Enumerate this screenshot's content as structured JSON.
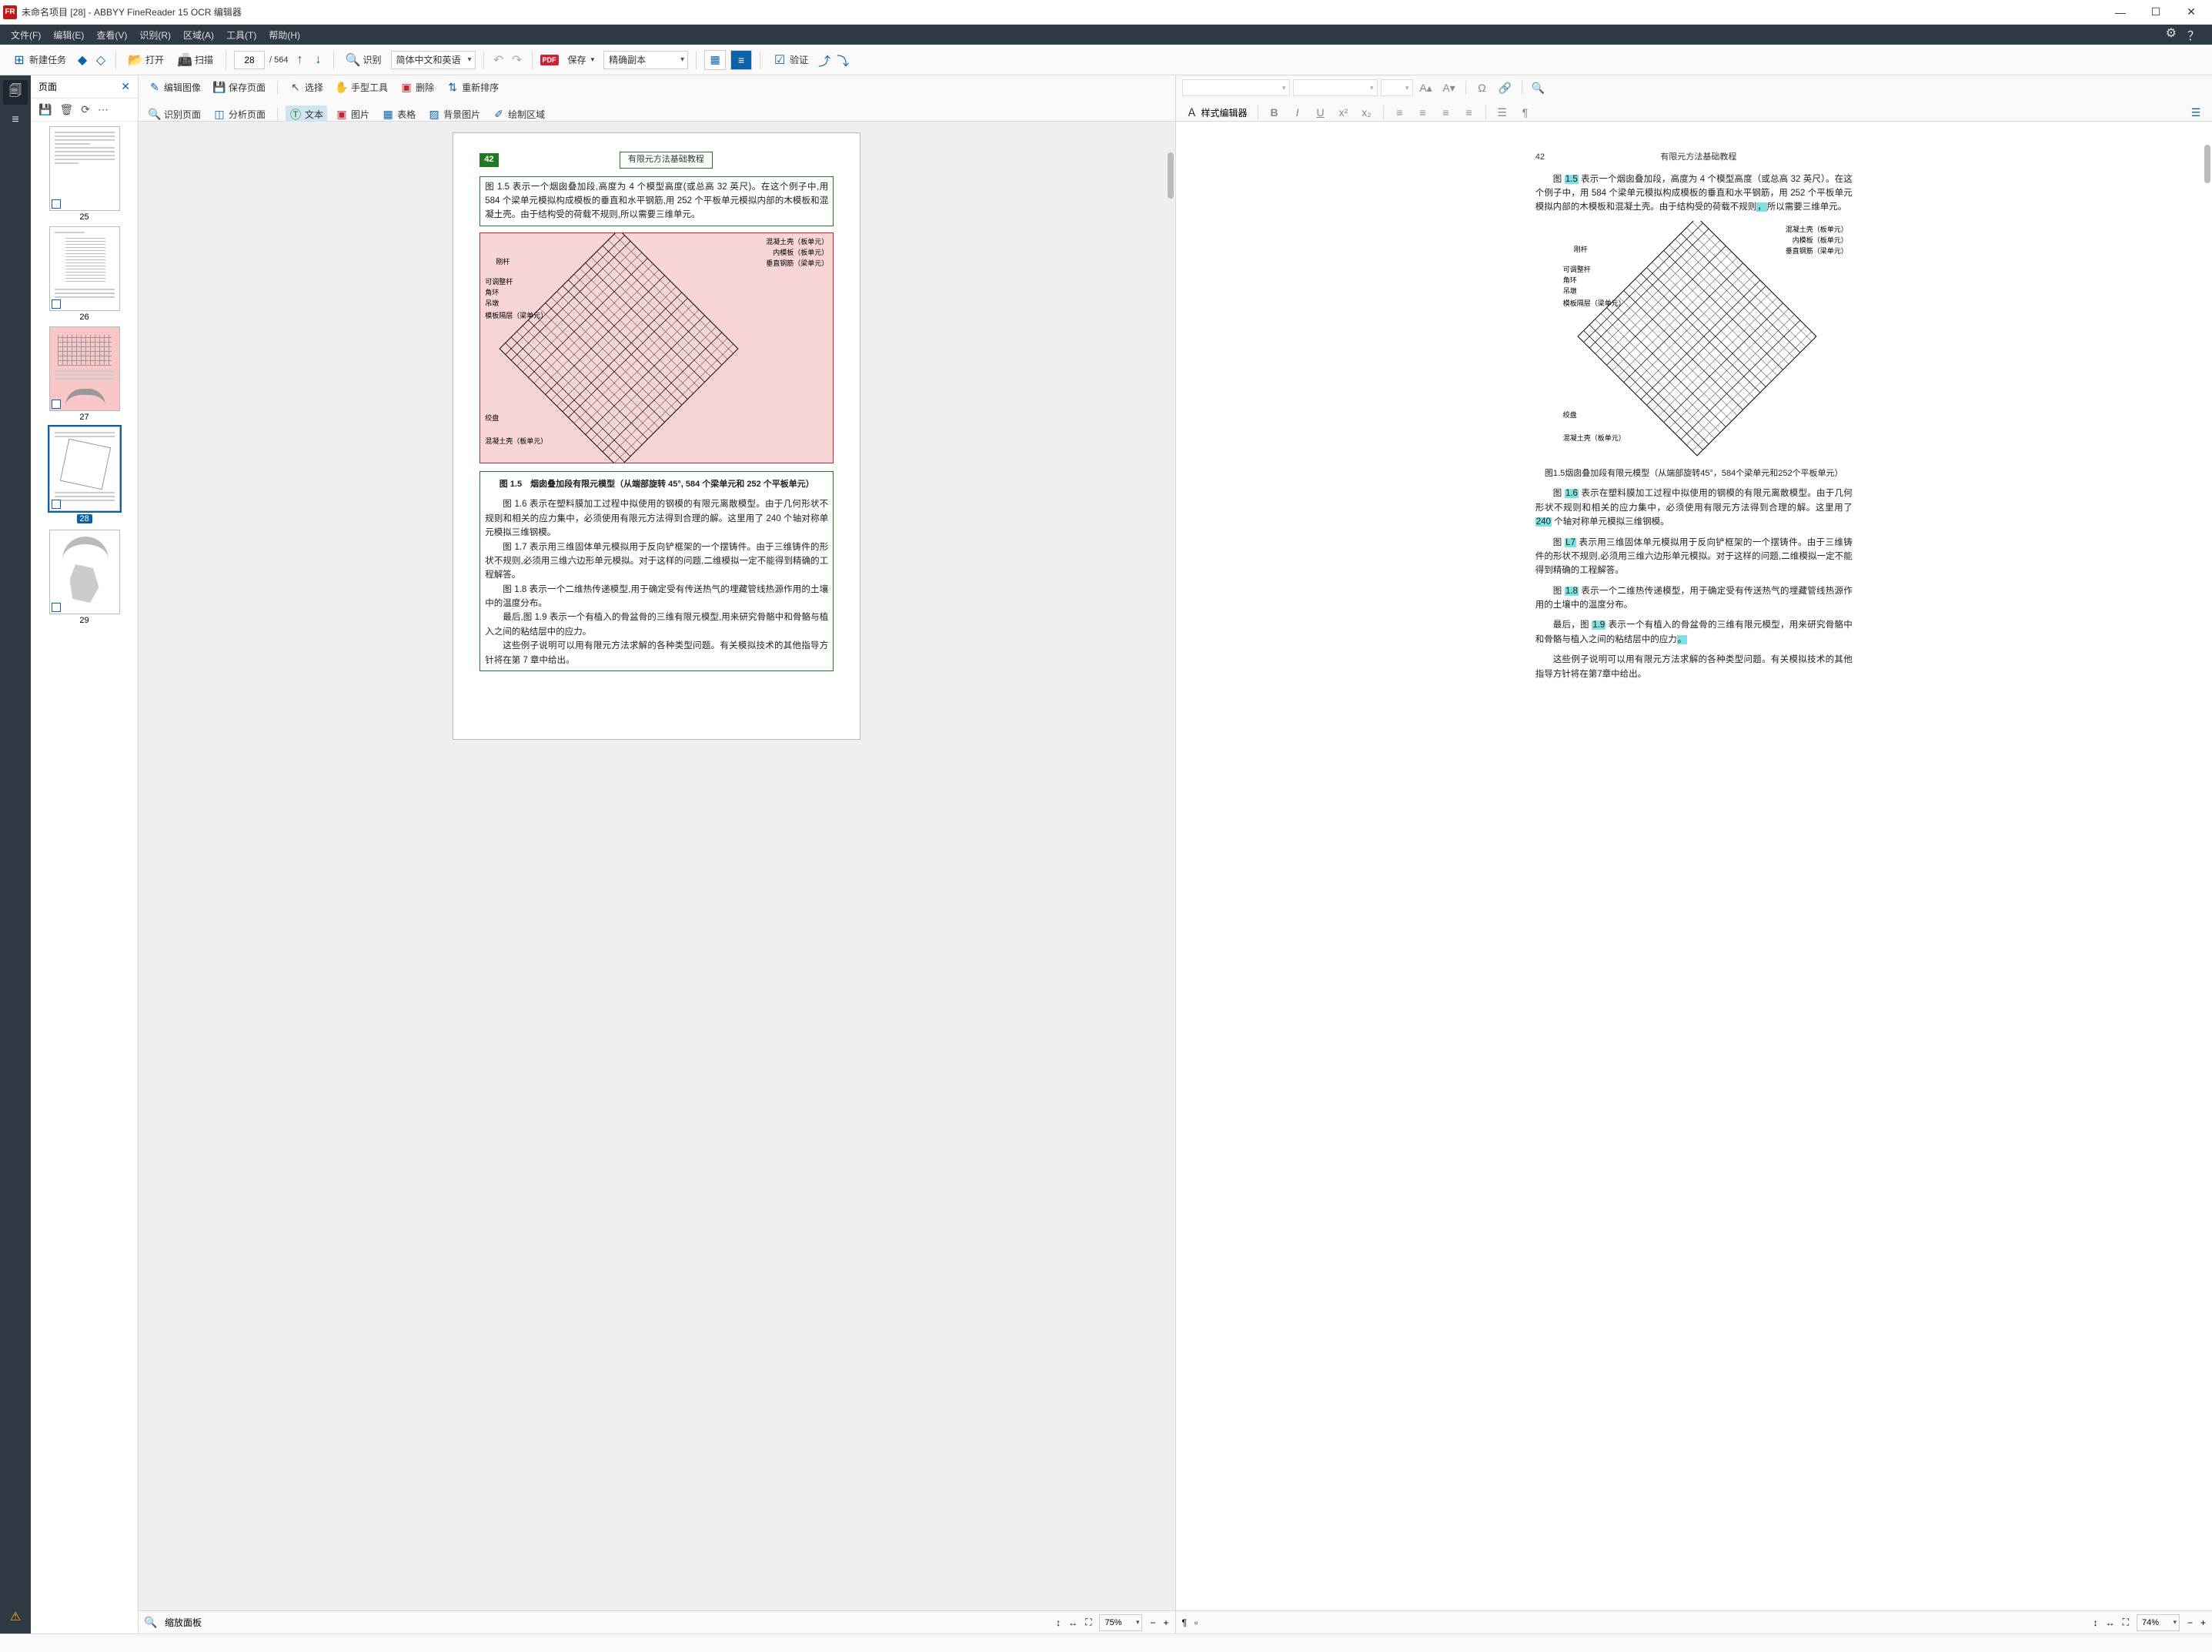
{
  "window": {
    "title": "未命名项目 [28] - ABBYY FineReader 15 OCR 编辑器",
    "app_icon_text": "FR"
  },
  "menu": {
    "file": "文件(F)",
    "edit": "编辑(E)",
    "view": "查看(V)",
    "recognize": "识别(R)",
    "area": "区域(A)",
    "tool": "工具(T)",
    "help": "帮助(H)"
  },
  "toolbar": {
    "new_task": "新建任务",
    "open": "打开",
    "scan": "扫描",
    "page_current": "28",
    "page_total": "/ 564",
    "recognize": "识别",
    "language": "简体中文和英语",
    "pdf_badge": "PDF",
    "save": "保存",
    "layout_mode": "精确副本",
    "verify": "验证"
  },
  "left_panel": {
    "tab_title": "页面",
    "thumbs": [
      {
        "num": "25"
      },
      {
        "num": "26"
      },
      {
        "num": "27",
        "pink": true
      },
      {
        "num": "28",
        "selected": true
      },
      {
        "num": "29"
      }
    ]
  },
  "image_toolbar": {
    "edit_image": "编辑图像",
    "save_page": "保存页面",
    "recognize_page": "识别页面",
    "analyze_page": "分析页面",
    "select": "选择",
    "hand": "手型工具",
    "delete": "删除",
    "reorder": "重新排序",
    "text": "文本",
    "image": "图片",
    "table": "表格",
    "bg_image": "背景图片",
    "draw_area": "绘制区域"
  },
  "image_status": {
    "label": "缩放面板",
    "zoom": "75%"
  },
  "text_toolbar": {
    "style_editor": "样式编辑器"
  },
  "text_status": {
    "zoom": "74%"
  },
  "ocr_page": {
    "page_number": "42",
    "header_title": "有限元方法基础教程",
    "para1": "图 1.5 表示一个烟囱叠加段,高度为 4 个模型高度(或总高 32 英尺)。在这个例子中,用 584 个梁单元模拟构成模板的垂直和水平钢筋,用 252 个平板单元模拟内部的木模板和混凝土壳。由于结构受的荷载不规则,所以需要三维单元。",
    "fig_labels": {
      "a": "混凝土壳（板单元）",
      "b": "内模板（板单元）",
      "c": "垂直钢筋（梁单元）",
      "d": "刚杆",
      "e": "可调整杆",
      "f": "角环",
      "g": "吊墩",
      "h": "模板隔层（梁单元）",
      "i": "绞盘",
      "j": "混凝土壳（板单元）"
    },
    "fig_caption": "图 1.5　烟囱叠加段有限元模型（从端部旋转 45°, 584 个梁单元和 252 个平板单元）",
    "para2": "图 1.6 表示在塑料膜加工过程中拟使用的钢模的有限元离散模型。由于几何形状不规则和相关的应力集中，必须使用有限元方法得到合理的解。这里用了 240 个轴对称单元模拟三维钢模。",
    "para3": "图 1.7 表示用三维固体单元模拟用于反向铲框架的一个摆铸件。由于三维铸件的形状不规则,必须用三维六边形单元模拟。对于这样的问题,二维模拟一定不能得到精确的工程解答。",
    "para4": "图 1.8 表示一个二维热传递模型,用于确定受有传送热气的埋藏管线热源作用的土壤中的温度分布。",
    "para5": "最后,图 1.9 表示一个有植入的骨盆骨的三维有限元模型,用来研究骨骼中和骨骼与植入之间的粘结层中的应力。",
    "para6": "这些例子说明可以用有限元方法求解的各种类型问题。有关模拟技术的其他指导方针将在第 7 章中给出。"
  },
  "text_page": {
    "page_number": "42",
    "header_title": "有限元方法基础教程",
    "para1_a": "图 ",
    "para1_hl1": "1.5",
    "para1_b": " 表示一个烟囱叠加段，高度为 4 个模型高度（或总高 32 英尺）。在这个例子中，用 584 个梁单元模拟构成模板的垂直和水平钢筋，用 252 个平板单元模拟内部的木模板和混凝土壳。由于结构受的荷载不规则",
    "para1_hl2": "，",
    "para1_c": "所以需要三维单元。",
    "fig_caption_a": "图",
    "fig_caption_hl": "1.5",
    "fig_caption_b": "烟囱叠加段有限元模型（从端部旋转45°，584个梁单元和252个平板单元）",
    "para2_a": "图 ",
    "para2_hl": "1.6",
    "para2_b": " 表示在塑料膜加工过程中拟使用的钢模的有限元离散模型。由于几何形状不规则和相关的应力集中，必须使用有限元方法得到合理的解。这里用了 ",
    "para2_hl2": "240",
    "para2_c": " 个轴对称单元模拟三维钢模。",
    "para3_a": "图 ",
    "para3_hl": "L7",
    "para3_b": " 表示用三维固体单元模拟用于反向铲框架的一个摆铸件。由于三维铸件的形状不规则,必须用三维六边形单元模拟。对于这样的问题,二维模拟一定不能得到精确的工程解答。",
    "para4_a": "图 ",
    "para4_hl": "1.8",
    "para4_b": " 表示一个二维热传递模型，用于确定受有传送热气的埋藏管线热源作用的土壤中的温度分布。",
    "para5_a": "最后，图 ",
    "para5_hl": "1.9",
    "para5_b": " 表示一个有植入的骨盆骨的三维有限元模型，用来研究骨骼中和骨骼与植入之间的粘结层中的应力",
    "para5_hl2": "。",
    "para6": "这些例子说明可以用有限元方法求解的各种类型问题。有关模拟技术的其他指导方针将在第7章中给出。"
  }
}
